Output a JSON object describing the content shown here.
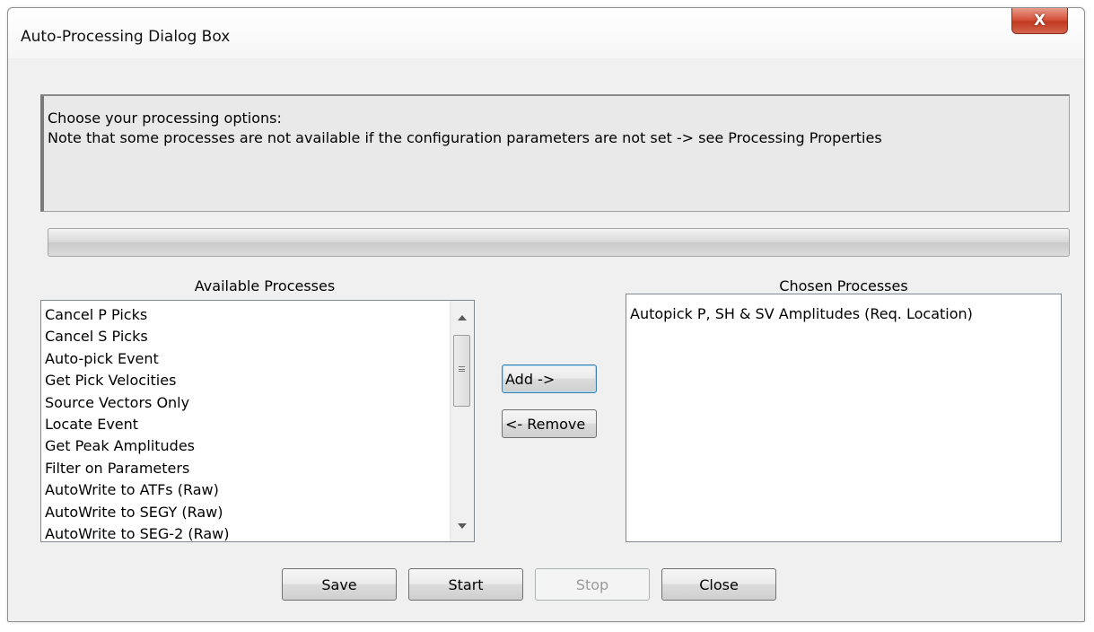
{
  "window": {
    "title": "Auto-Processing Dialog Box",
    "close_glyph": "X"
  },
  "info": {
    "line1": "Choose your processing options:",
    "line2": "Note that some processes are not available if the configuration parameters are not set -> see Processing Properties"
  },
  "progress": {
    "value": 0
  },
  "available": {
    "label": "Available Processes",
    "items": [
      "Cancel P Picks",
      "Cancel S Picks",
      "Auto-pick Event",
      "Get Pick Velocities",
      "Source Vectors Only",
      "Locate Event",
      "Get Peak Amplitudes",
      "Filter on Parameters",
      "AutoWrite to ATFs (Raw)",
      "AutoWrite to SEGY (Raw)",
      "AutoWrite to SEG-2 (Raw)"
    ]
  },
  "chosen": {
    "label": "Chosen Processes",
    "items": [
      "Autopick P, SH & SV Amplitudes (Req. Location)"
    ]
  },
  "buttons": {
    "add": "Add ->",
    "remove": "<- Remove",
    "save": "Save",
    "start": "Start",
    "stop": "Stop",
    "close": "Close"
  },
  "colors": {
    "close_button": "#c94a34",
    "default_button_border": "#3c7fb1",
    "dialog_background": "#f0f0f0"
  },
  "icons": {
    "close": "close-icon",
    "scroll_up": "chevron-up-icon",
    "scroll_down": "chevron-down-icon"
  }
}
